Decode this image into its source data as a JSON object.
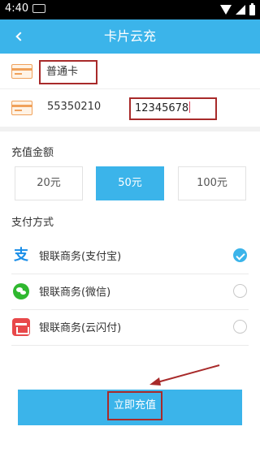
{
  "status_bar": {
    "time": "4:40"
  },
  "header": {
    "title": "卡片云充"
  },
  "card": {
    "type_label": "普通卡",
    "number": "55350210",
    "password": "12345678"
  },
  "amount_section": {
    "label": "充值金额",
    "options": [
      {
        "label": "20元",
        "selected": false
      },
      {
        "label": "50元",
        "selected": true
      },
      {
        "label": "100元",
        "selected": false
      }
    ]
  },
  "payment_section": {
    "label": "支付方式",
    "methods": [
      {
        "label": "银联商务(支付宝)",
        "icon": "alipay-icon",
        "checked": true
      },
      {
        "label": "银联商务(微信)",
        "icon": "wechat-icon",
        "checked": false
      },
      {
        "label": "银联商务(云闪付)",
        "icon": "quickpass-icon",
        "checked": false
      }
    ]
  },
  "submit": {
    "label": "立即充值"
  },
  "colors": {
    "accent": "#3bb4ea",
    "annotation": "#a82a2a"
  }
}
